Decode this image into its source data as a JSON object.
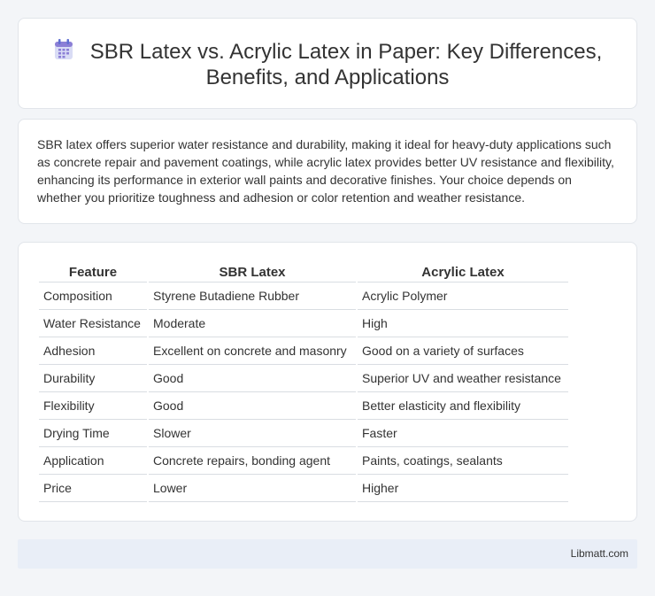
{
  "header": {
    "icon": "calendar-icon",
    "title": "SBR Latex vs. Acrylic Latex in Paper: Key Differences, Benefits, and Applications"
  },
  "summary": "SBR latex offers superior water resistance and durability, making it ideal for heavy-duty applications such as concrete repair and pavement coatings, while acrylic latex provides better UV resistance and flexibility, enhancing its performance in exterior wall paints and decorative finishes. Your choice depends on whether you prioritize toughness and adhesion or color retention and weather resistance.",
  "table": {
    "headers": [
      "Feature",
      "SBR Latex",
      "Acrylic Latex"
    ],
    "rows": [
      [
        "Composition",
        "Styrene Butadiene Rubber",
        "Acrylic Polymer"
      ],
      [
        "Water Resistance",
        "Moderate",
        "High"
      ],
      [
        "Adhesion",
        "Excellent on concrete and masonry",
        "Good on a variety of surfaces"
      ],
      [
        "Durability",
        "Good",
        "Superior UV and weather resistance"
      ],
      [
        "Flexibility",
        "Good",
        "Better elasticity and flexibility"
      ],
      [
        "Drying Time",
        "Slower",
        "Faster"
      ],
      [
        "Application",
        "Concrete repairs, bonding agent",
        "Paints, coatings, sealants"
      ],
      [
        "Price",
        "Lower",
        "Higher"
      ]
    ]
  },
  "footer": {
    "brand": "Libmatt.com"
  },
  "colors": {
    "background": "#f3f5f8",
    "footer_bg": "#e9eef7",
    "icon_accent": "#8b7fd6"
  }
}
